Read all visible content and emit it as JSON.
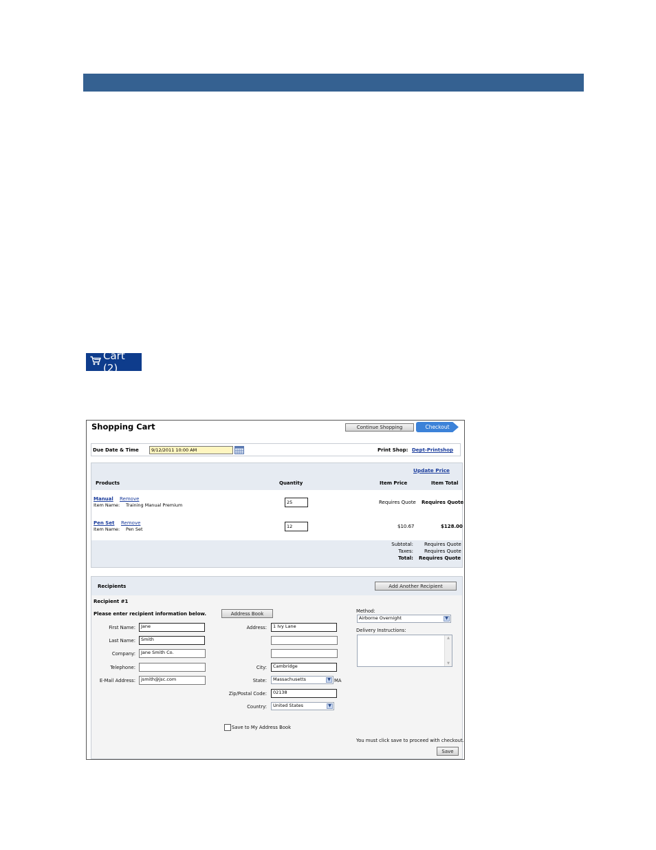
{
  "cart_badge": {
    "label": "Cart (2)",
    "icon": "cart-icon"
  },
  "cart": {
    "title": "Shopping Cart",
    "continue_label": "Continue Shopping",
    "checkout_label": "Checkout",
    "due_label": "Due Date & Time",
    "due_value": "9/12/2011 10:00 AM",
    "print_shop_label": "Print Shop:",
    "print_shop_value": "Dept-Printshop",
    "update_price": "Update Price",
    "col_products": "Products",
    "col_quantity": "Quantity",
    "col_price": "Item Price",
    "col_total": "Item Total",
    "remove_label": "Remove",
    "item_name_label": "Item Name:",
    "items": [
      {
        "name": "Manual",
        "item_name": "Training Manual Premium",
        "qty": "25",
        "price": "Requires Quote",
        "total": "Requires Quote"
      },
      {
        "name": "Pen Set",
        "item_name": "Pen Set",
        "qty": "12",
        "price": "$10.67",
        "total": "$128.00"
      }
    ],
    "subtotal_label": "Subtotal:",
    "subtotal_value": "Requires Quote",
    "taxes_label": "Taxes:",
    "taxes_value": "Requires Quote",
    "total_label": "Total:",
    "total_value": "Requires Quote"
  },
  "recipients": {
    "header": "Recipients",
    "add_label": "Add Another Recipient",
    "recipient_title": "Recipient #1",
    "instructions": "Please enter recipient information below.",
    "address_book_label": "Address Book",
    "first_name_label": "First Name:",
    "first_name": "Jane",
    "last_name_label": "Last Name:",
    "last_name": "Smith",
    "company_label": "Company:",
    "company": "Jane Smith Co.",
    "telephone_label": "Telephone:",
    "telephone": "",
    "email_label": "E-Mail Address:",
    "email": "jsmith@jsc.com",
    "address_label": "Address:",
    "address1": "1 Ivy Lane",
    "address2": "",
    "address3": "",
    "city_label": "City:",
    "city": "Cambridge",
    "state_label": "State:",
    "state": "Massachusetts",
    "state_abbr": "MA",
    "zip_label": "Zip/Postal Code:",
    "zip": "02138",
    "country_label": "Country:",
    "country": "United States",
    "method_label": "Method:",
    "method": "Airborne Overnight",
    "delivery_label": "Delivery Instructions:",
    "save_address_label": "Save to My Address Book",
    "save_note": "You must click save to proceed with checkout.",
    "save_label": "Save"
  }
}
